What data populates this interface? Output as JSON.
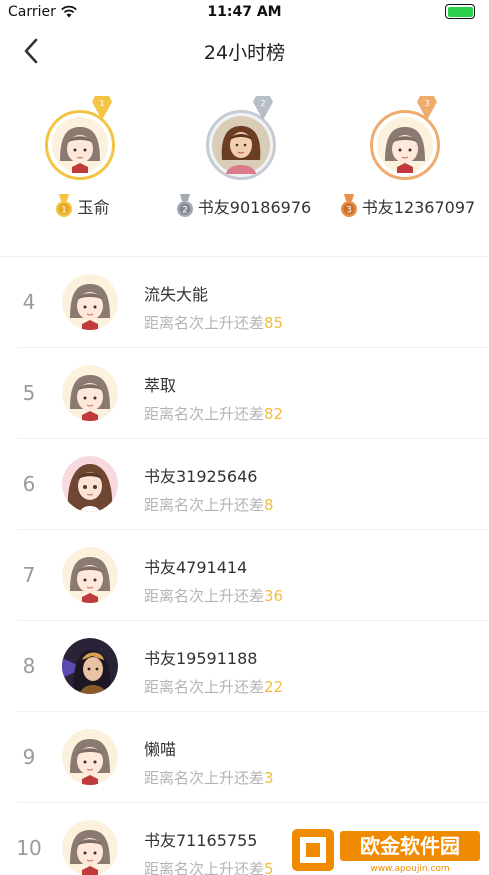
{
  "status_bar": {
    "carrier": "Carrier",
    "time": "11:47 AM"
  },
  "nav": {
    "title": "24小时榜"
  },
  "podium": [
    {
      "rank": "1",
      "name": "玉俞",
      "avatar": "chibi-girl-avatar",
      "color": "#f4c444"
    },
    {
      "rank": "2",
      "name": "书友90186976",
      "avatar": "painted-girl-avatar",
      "color": "#a3aab4"
    },
    {
      "rank": "3",
      "name": "书友12367097",
      "avatar": "chibi-girl-avatar",
      "color": "#e8904a"
    }
  ],
  "gap_prefix": "距离名次上升还差",
  "list": [
    {
      "rank": "4",
      "name": "流失大能",
      "gap": "85",
      "avatar": "chibi-girl-avatar"
    },
    {
      "rank": "5",
      "name": "萃取",
      "gap": "82",
      "avatar": "chibi-girl-avatar"
    },
    {
      "rank": "6",
      "name": "书友31925646",
      "gap": "8",
      "avatar": "anime-girl-avatar"
    },
    {
      "rank": "7",
      "name": "书友4791414",
      "gap": "36",
      "avatar": "chibi-girl-avatar"
    },
    {
      "rank": "8",
      "name": "书友19591188",
      "gap": "22",
      "avatar": "dark-warrior-avatar"
    },
    {
      "rank": "9",
      "name": "懒喵",
      "gap": "3",
      "avatar": "chibi-girl-avatar"
    },
    {
      "rank": "10",
      "name": "书友71165755",
      "gap": "5",
      "avatar": "chibi-girl-avatar"
    }
  ],
  "watermark": {
    "text": "欧金软件园",
    "url": "www.apoujin.com"
  },
  "colors": {
    "accent": "#f2bd3a",
    "gold": "#f4c444",
    "silver": "#c6ccd4",
    "bronze": "#efab6c"
  }
}
